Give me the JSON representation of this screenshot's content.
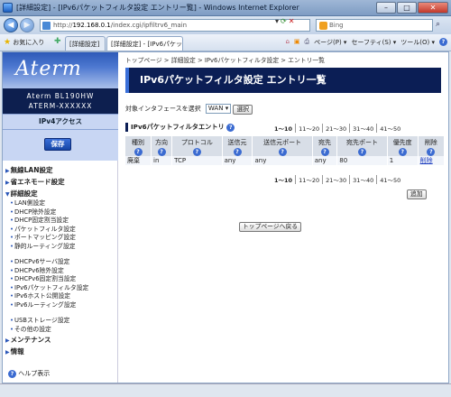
{
  "window": {
    "title": "[詳細設定] - [IPv6パケットフィルタ設定 エントリー覧] - Windows Internet Explorer",
    "close": "✕",
    "min": "–",
    "max": "□"
  },
  "address": {
    "url_host": "192.168.0.1",
    "url_prefix": "http://",
    "url_path": "/index.cgi/ipfiltrv6_main",
    "search_placeholder": "Bing"
  },
  "favorites": {
    "label": "お気に入り",
    "tab1": "[詳細設定]",
    "tab2": "[詳細設定] - [IPv6パケットフィルタ...",
    "page": "ページ(P)",
    "safety": "セーフティ(S)",
    "tools": "ツール(O)",
    "help": "?"
  },
  "leftnav": {
    "logo": "Aterm",
    "model_line1": "Aterm BL190HW",
    "model_line2": "ATERM-XXXXXX",
    "mode": "IPv4アクセス",
    "save": "保存",
    "menu": {
      "wireless": "無線LAN設定",
      "eco": "省エネモード設定",
      "advanced": "詳細設定",
      "items1": [
        "LAN側設定",
        "DHCP除外設定",
        "DHCP固定割当設定",
        "パケットフィルタ設定",
        "ポートマッピング設定",
        "静的ルーティング設定"
      ],
      "items2": [
        "DHCPv6サーバ設定",
        "DHCPv6除外設定",
        "DHCPv6固定割当設定",
        "IPv6パケットフィルタ設定",
        "IPv6ホスト公開設定",
        "IPv6ルーティング設定"
      ],
      "items3": [
        "USBストレージ設定",
        "その他の設定"
      ],
      "maintenance": "メンテナンス",
      "info": "情報"
    },
    "help": "ヘルプ表示"
  },
  "main": {
    "breadcrumb": "トップページ > 詳細設定 > IPv6パケットフィルタ設定 > エントリ一覧",
    "title": "IPv6パケットフィルタ設定 エントリ一覧",
    "iface_label": "対象インタフェースを選択",
    "iface_value": "WAN",
    "iface_button": "選択",
    "section": "IPv6パケットフィルタエントリ",
    "pages": [
      "1〜10",
      "11〜20",
      "21〜30",
      "31〜40",
      "41〜50"
    ],
    "columns": [
      "種別",
      "方向",
      "プロトコル",
      "送信元",
      "送信元ポート",
      "宛先",
      "宛先ポート",
      "優先度",
      "削除"
    ],
    "rows": [
      [
        "廃棄",
        "in",
        "TCP",
        "any",
        "any",
        "any",
        "80",
        "1",
        "削除"
      ]
    ],
    "add_button": "追加",
    "back_button": "トップページへ戻る"
  }
}
